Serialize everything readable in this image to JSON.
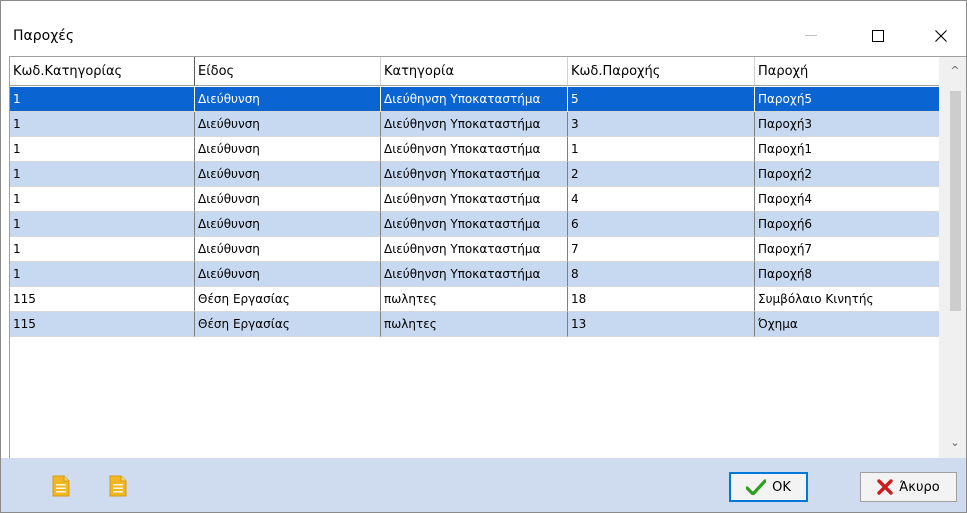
{
  "window": {
    "title": "Παροχές"
  },
  "grid": {
    "columns": [
      "Κωδ.Κατηγορίας",
      "Είδος",
      "Κατηγορία",
      "Κωδ.Παροχής",
      "Παροχή"
    ],
    "rows": [
      [
        "1",
        "Διεύθυνση",
        "Διεύθηνση Υποκαταστήμα",
        "5",
        "Παροχή5"
      ],
      [
        "1",
        "Διεύθυνση",
        "Διεύθηνση Υποκαταστήμα",
        "3",
        "Παροχή3"
      ],
      [
        "1",
        "Διεύθυνση",
        "Διεύθηνση Υποκαταστήμα",
        "1",
        "Παροχή1"
      ],
      [
        "1",
        "Διεύθυνση",
        "Διεύθηνση Υποκαταστήμα",
        "2",
        "Παροχή2"
      ],
      [
        "1",
        "Διεύθυνση",
        "Διεύθηνση Υποκαταστήμα",
        "4",
        "Παροχή4"
      ],
      [
        "1",
        "Διεύθυνση",
        "Διεύθηνση Υποκαταστήμα",
        "6",
        "Παροχή6"
      ],
      [
        "1",
        "Διεύθυνση",
        "Διεύθηνση Υποκαταστήμα",
        "7",
        "Παροχή7"
      ],
      [
        "1",
        "Διεύθυνση",
        "Διεύθηνση Υποκαταστήμα",
        "8",
        "Παροχή8"
      ],
      [
        "115",
        "Θέση Εργασίας",
        "πωλητες",
        "18",
        "Συμβόλαιο Κινητής"
      ],
      [
        "115",
        "Θέση Εργασίας",
        "πωλητες",
        "13",
        "Όχημα"
      ]
    ],
    "selected_row": 0
  },
  "footer": {
    "icons": [
      "document-icon",
      "document-icon"
    ],
    "ok_label": "OK",
    "cancel_label": "Άκυρο"
  },
  "colors": {
    "selection": "#0a64d2",
    "alt_row": "#c6d9f1",
    "footer_bg": "#cfdcf0",
    "ok_check": "#2e9e1e",
    "cancel_x": "#cc1b1b",
    "doc_icon": "#f0b624"
  }
}
